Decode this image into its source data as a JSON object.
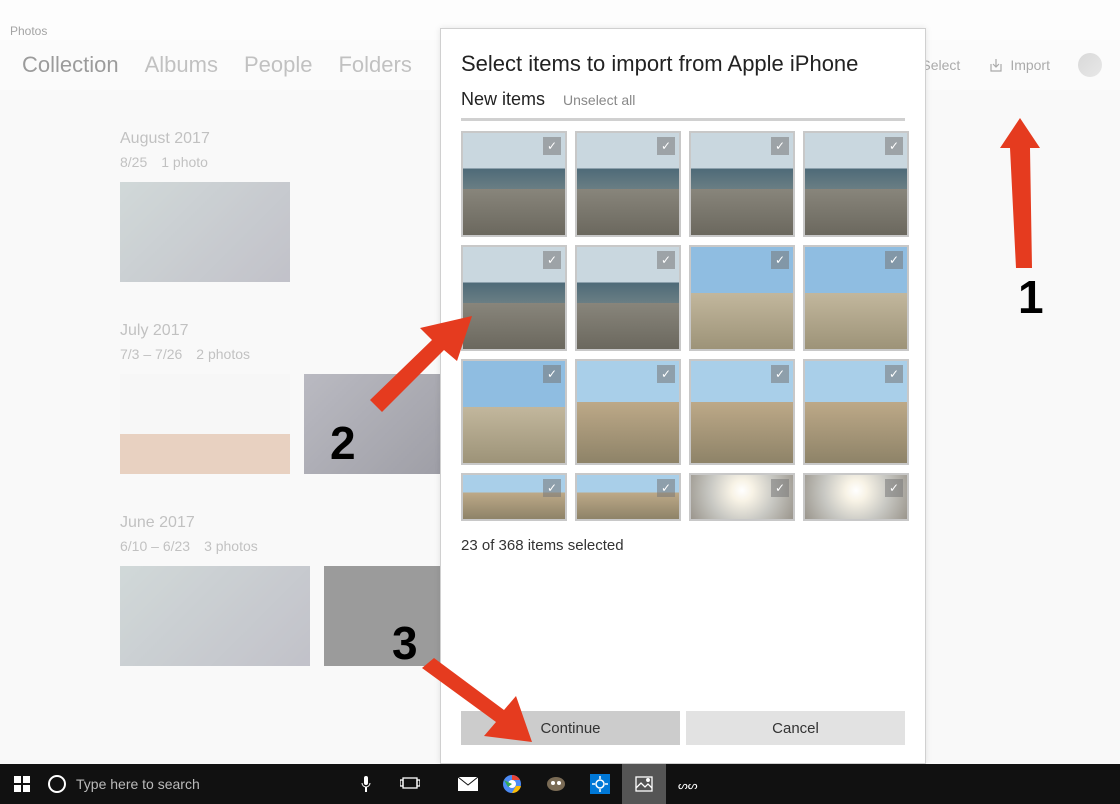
{
  "titlebar": {
    "app_name": "Photos"
  },
  "nav": {
    "collection": "Collection",
    "albums": "Albums",
    "people": "People",
    "folders": "Folders"
  },
  "header_right": {
    "select": "Select",
    "import": "Import"
  },
  "groups": [
    {
      "title": "August 2017",
      "range": "8/25",
      "count": "1 photo"
    },
    {
      "title": "July 2017",
      "range": "7/3 – 7/26",
      "count": "2 photos"
    },
    {
      "title": "June 2017",
      "range": "6/10 – 6/23",
      "count": "3 photos"
    }
  ],
  "modal": {
    "title": "Select items to import from Apple iPhone",
    "new_items": "New items",
    "unselect": "Unselect all",
    "status": "23 of 368 items selected",
    "continue": "Continue",
    "cancel": "Cancel"
  },
  "annotations": {
    "one": "1",
    "two": "2",
    "three": "3"
  },
  "taskbar": {
    "search_placeholder": "Type here to search"
  }
}
